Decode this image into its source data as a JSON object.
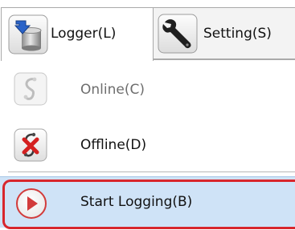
{
  "tabs": [
    {
      "label": "Logger(L)",
      "icon": "logger-icon",
      "selected": true
    },
    {
      "label": "Setting(S)",
      "icon": "wrench-icon",
      "selected": false
    }
  ],
  "menu": {
    "items": [
      {
        "label": "Online(C)",
        "icon": "online-icon",
        "enabled": false
      },
      {
        "label": "Offline(D)",
        "icon": "offline-icon",
        "enabled": true
      },
      {
        "label": "Start Logging(B)",
        "icon": "start-logging-icon",
        "enabled": true,
        "highlighted": true
      }
    ]
  },
  "colors": {
    "hover_background": "#cfe3f7",
    "highlight_border": "#d8262c",
    "disabled_text": "#6d6d6d"
  }
}
